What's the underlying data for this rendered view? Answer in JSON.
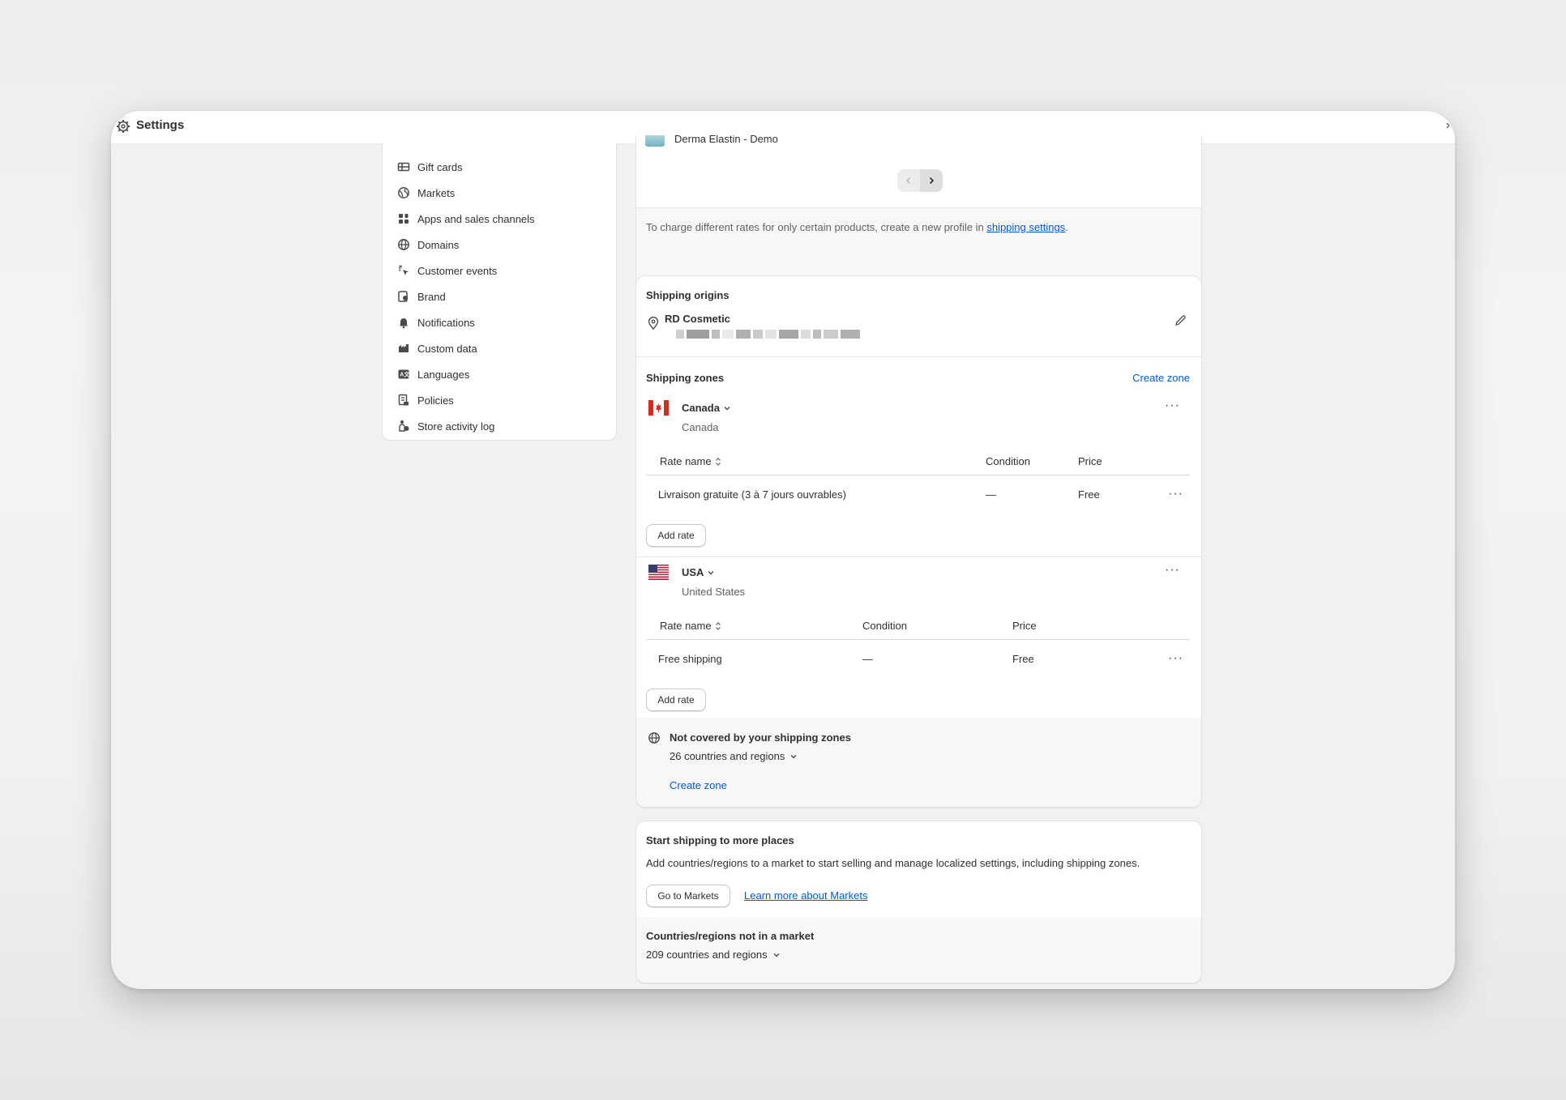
{
  "window": {
    "title": "Settings"
  },
  "sidebar": {
    "items": [
      {
        "label": "Gift cards",
        "icon": "gift-card-icon"
      },
      {
        "label": "Markets",
        "icon": "globe-markets-icon"
      },
      {
        "label": "Apps and sales channels",
        "icon": "apps-icon"
      },
      {
        "label": "Domains",
        "icon": "globe-icon"
      },
      {
        "label": "Customer events",
        "icon": "cursor-click-icon"
      },
      {
        "label": "Brand",
        "icon": "brand-icon"
      },
      {
        "label": "Notifications",
        "icon": "bell-icon"
      },
      {
        "label": "Custom data",
        "icon": "custom-data-icon"
      },
      {
        "label": "Languages",
        "icon": "language-icon"
      },
      {
        "label": "Policies",
        "icon": "policy-icon"
      },
      {
        "label": "Store activity log",
        "icon": "activity-log-icon"
      }
    ]
  },
  "products_card": {
    "product_name": "Derma Elastin - Demo",
    "footer_text": "To charge different rates for only certain products, create a new profile in ",
    "footer_link": "shipping settings",
    "footer_end": "."
  },
  "shipping_origins": {
    "heading": "Shipping origins",
    "location_name": "RD Cosmetic"
  },
  "shipping_zones": {
    "heading": "Shipping zones",
    "create_zone": "Create zone",
    "zones": [
      {
        "name": "Canada",
        "subtitle": "Canada",
        "columns": [
          "Rate name",
          "Condition",
          "Price"
        ],
        "rates": [
          {
            "name": "Livraison gratuite (3 à 7 jours ouvrables)",
            "condition": "—",
            "price": "Free"
          }
        ],
        "add_rate": "Add rate"
      },
      {
        "name": "USA",
        "subtitle": "United States",
        "columns": [
          "Rate name",
          "Condition",
          "Price"
        ],
        "rates": [
          {
            "name": "Free shipping",
            "condition": "—",
            "price": "Free"
          }
        ],
        "add_rate": "Add rate"
      }
    ],
    "not_covered": {
      "title": "Not covered by your shipping zones",
      "count": "26 countries and regions",
      "create_zone": "Create zone"
    }
  },
  "more_places": {
    "heading": "Start shipping to more places",
    "description": "Add countries/regions to a market to start selling and manage localized settings, including shipping zones.",
    "button": "Go to Markets",
    "link": "Learn more about Markets",
    "not_in_market_title": "Countries/regions not in a market",
    "not_in_market_count": "209 countries and regions"
  },
  "colors": {
    "accent": "#005bd3",
    "text": "#303030",
    "background": "#f1f1f1"
  }
}
